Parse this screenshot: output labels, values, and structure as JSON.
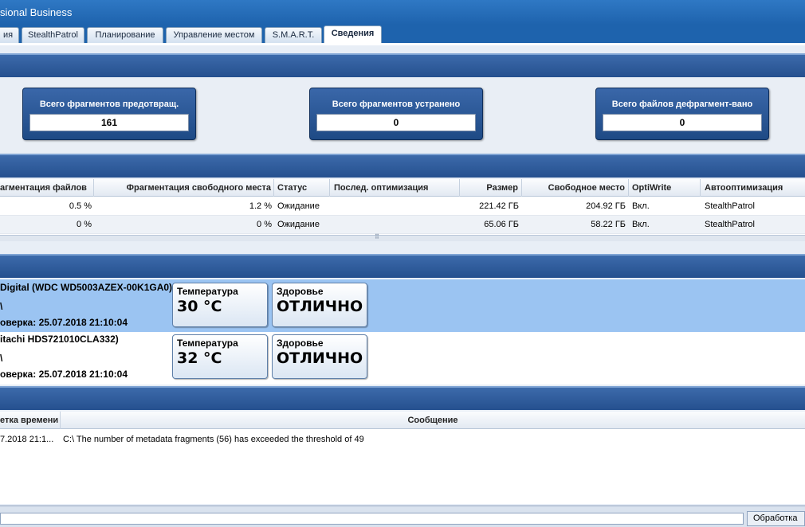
{
  "window": {
    "title": "sional Business"
  },
  "tabs": [
    {
      "label": "ия"
    },
    {
      "label": "StealthPatrol"
    },
    {
      "label": "Планирование"
    },
    {
      "label": "Управление местом"
    },
    {
      "label": "S.M.A.R.T."
    },
    {
      "label": "Сведения"
    }
  ],
  "active_tab": "Сведения",
  "stats": [
    {
      "label": "Всего фрагментов предотвращ.",
      "value": "161"
    },
    {
      "label": "Всего фрагментов устранено",
      "value": "0"
    },
    {
      "label": "Всего файлов дефрагмент-вано",
      "value": "0"
    }
  ],
  "drive_table": {
    "columns": [
      "агментация файлов",
      "Фрагментация свободного места",
      "Статус",
      "Послед. оптимизация",
      "Размер",
      "Свободное место",
      "OptiWrite",
      "Автооптимизация"
    ],
    "rows": [
      {
        "file_frag": "0.5 %",
        "free_frag": "1.2 %",
        "status": "Ожидание",
        "last_opt": "",
        "size": "221.42 ГБ",
        "free": "204.92 ГБ",
        "optiwrite": "Вкл.",
        "auto": "StealthPatrol"
      },
      {
        "file_frag": "0 %",
        "free_frag": "0 %",
        "status": "Ожидание",
        "last_opt": "",
        "size": "65.06 ГБ",
        "free": "58.22 ГБ",
        "optiwrite": "Вкл.",
        "auto": "StealthPatrol"
      }
    ],
    "splitter_glyph": "⠿"
  },
  "health": [
    {
      "name": "Digital (WDC WD5003AZEX-00K1GA0)",
      "letter": "\\",
      "check": "оверка: 25.07.2018 21:10:04",
      "temp_label": "Температура",
      "temp": "30 °C",
      "health_label": "Здоровье",
      "health": "ОТЛИЧНО",
      "selected": true
    },
    {
      "name": "itachi HDS721010CLA332)",
      "letter": "\\",
      "check": "оверка: 25.07.2018 21:10:04",
      "temp_label": "Температура",
      "temp": "32 °C",
      "health_label": "Здоровье",
      "health": "ОТЛИЧНО",
      "selected": false
    }
  ],
  "log": {
    "columns": [
      "етка времени",
      "Сообщение"
    ],
    "rows": [
      {
        "time": "7.2018 21:1...",
        "message": "C:\\ The number of metadata fragments (56) has exceeded the threshold of 49"
      }
    ]
  },
  "status": {
    "text": "Обработка"
  }
}
